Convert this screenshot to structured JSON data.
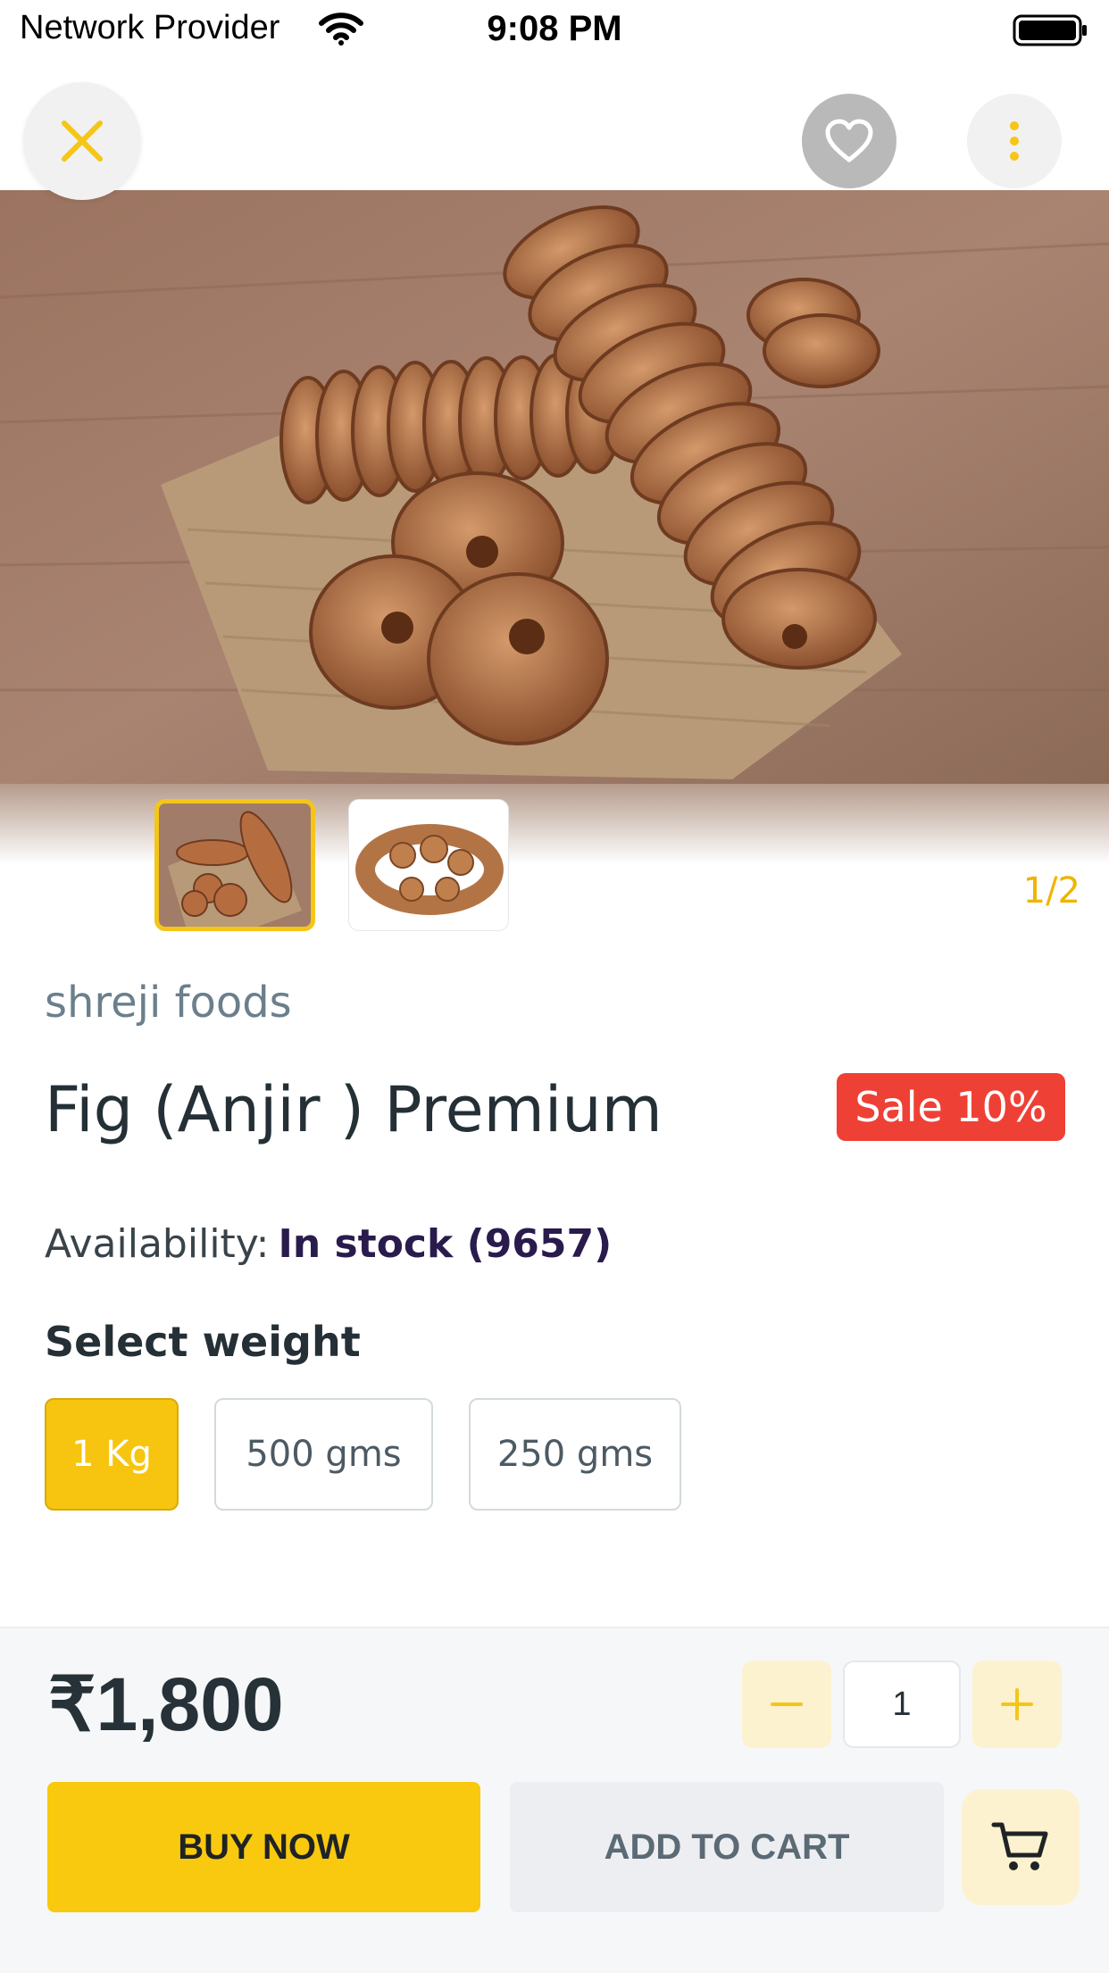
{
  "status_bar": {
    "carrier": "Network Provider",
    "time": "9:08 PM"
  },
  "header": {
    "close_icon": "close-icon",
    "favorite_icon": "heart-icon",
    "more_icon": "more-vertical-icon"
  },
  "gallery": {
    "counter": "1/2",
    "selected_index": 0,
    "thumbnail_count": 2
  },
  "product": {
    "brand": "shreji foods",
    "title": "Fig (Anjir ) Premium",
    "sale_badge": "Sale 10%",
    "availability_label": "Availability:",
    "availability_value": "In stock  (9657)",
    "select_weight_label": "Select weight",
    "weights": [
      "1 Kg",
      "500 gms",
      "250 gms"
    ],
    "selected_weight": "1 Kg"
  },
  "footer": {
    "price": "₹1,800",
    "quantity": "1",
    "buy_now": "BUY NOW",
    "add_to_cart": "ADD TO CART",
    "cart_icon": "cart-icon"
  },
  "colors": {
    "accent": "#F7C50F",
    "sale": "#EF4036",
    "text_dark": "#242F36"
  }
}
